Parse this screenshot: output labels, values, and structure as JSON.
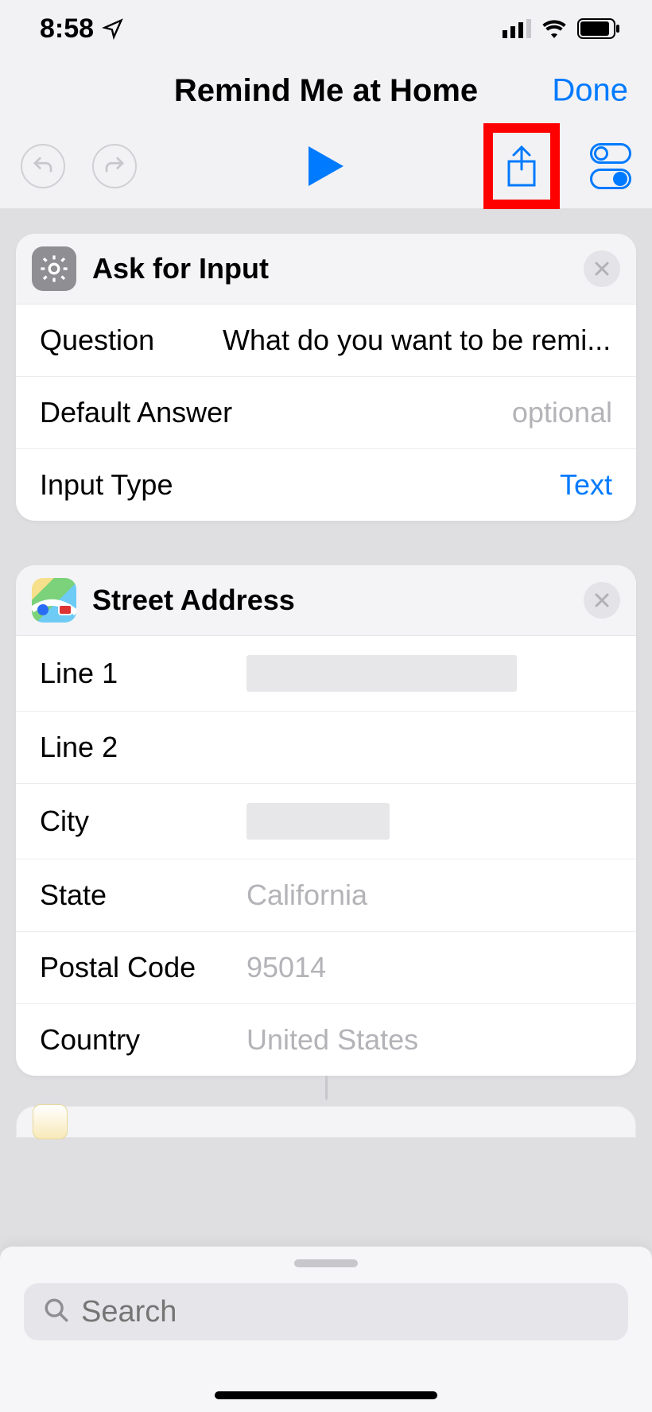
{
  "status": {
    "time": "8:58"
  },
  "nav": {
    "title": "Remind Me at Home",
    "done": "Done"
  },
  "cards": {
    "askInput": {
      "title": "Ask for Input",
      "rows": {
        "questionLabel": "Question",
        "questionValue": "What do you want to be remi...",
        "defaultLabel": "Default Answer",
        "defaultPlaceholder": "optional",
        "inputTypeLabel": "Input Type",
        "inputTypeValue": "Text"
      }
    },
    "address": {
      "title": "Street Address",
      "rows": {
        "line1Label": "Line 1",
        "line2Label": "Line 2",
        "cityLabel": "City",
        "stateLabel": "State",
        "stateValue": "California",
        "postalLabel": "Postal Code",
        "postalValue": "95014",
        "countryLabel": "Country",
        "countryValue": "United States"
      }
    }
  },
  "search": {
    "placeholder": "Search"
  }
}
